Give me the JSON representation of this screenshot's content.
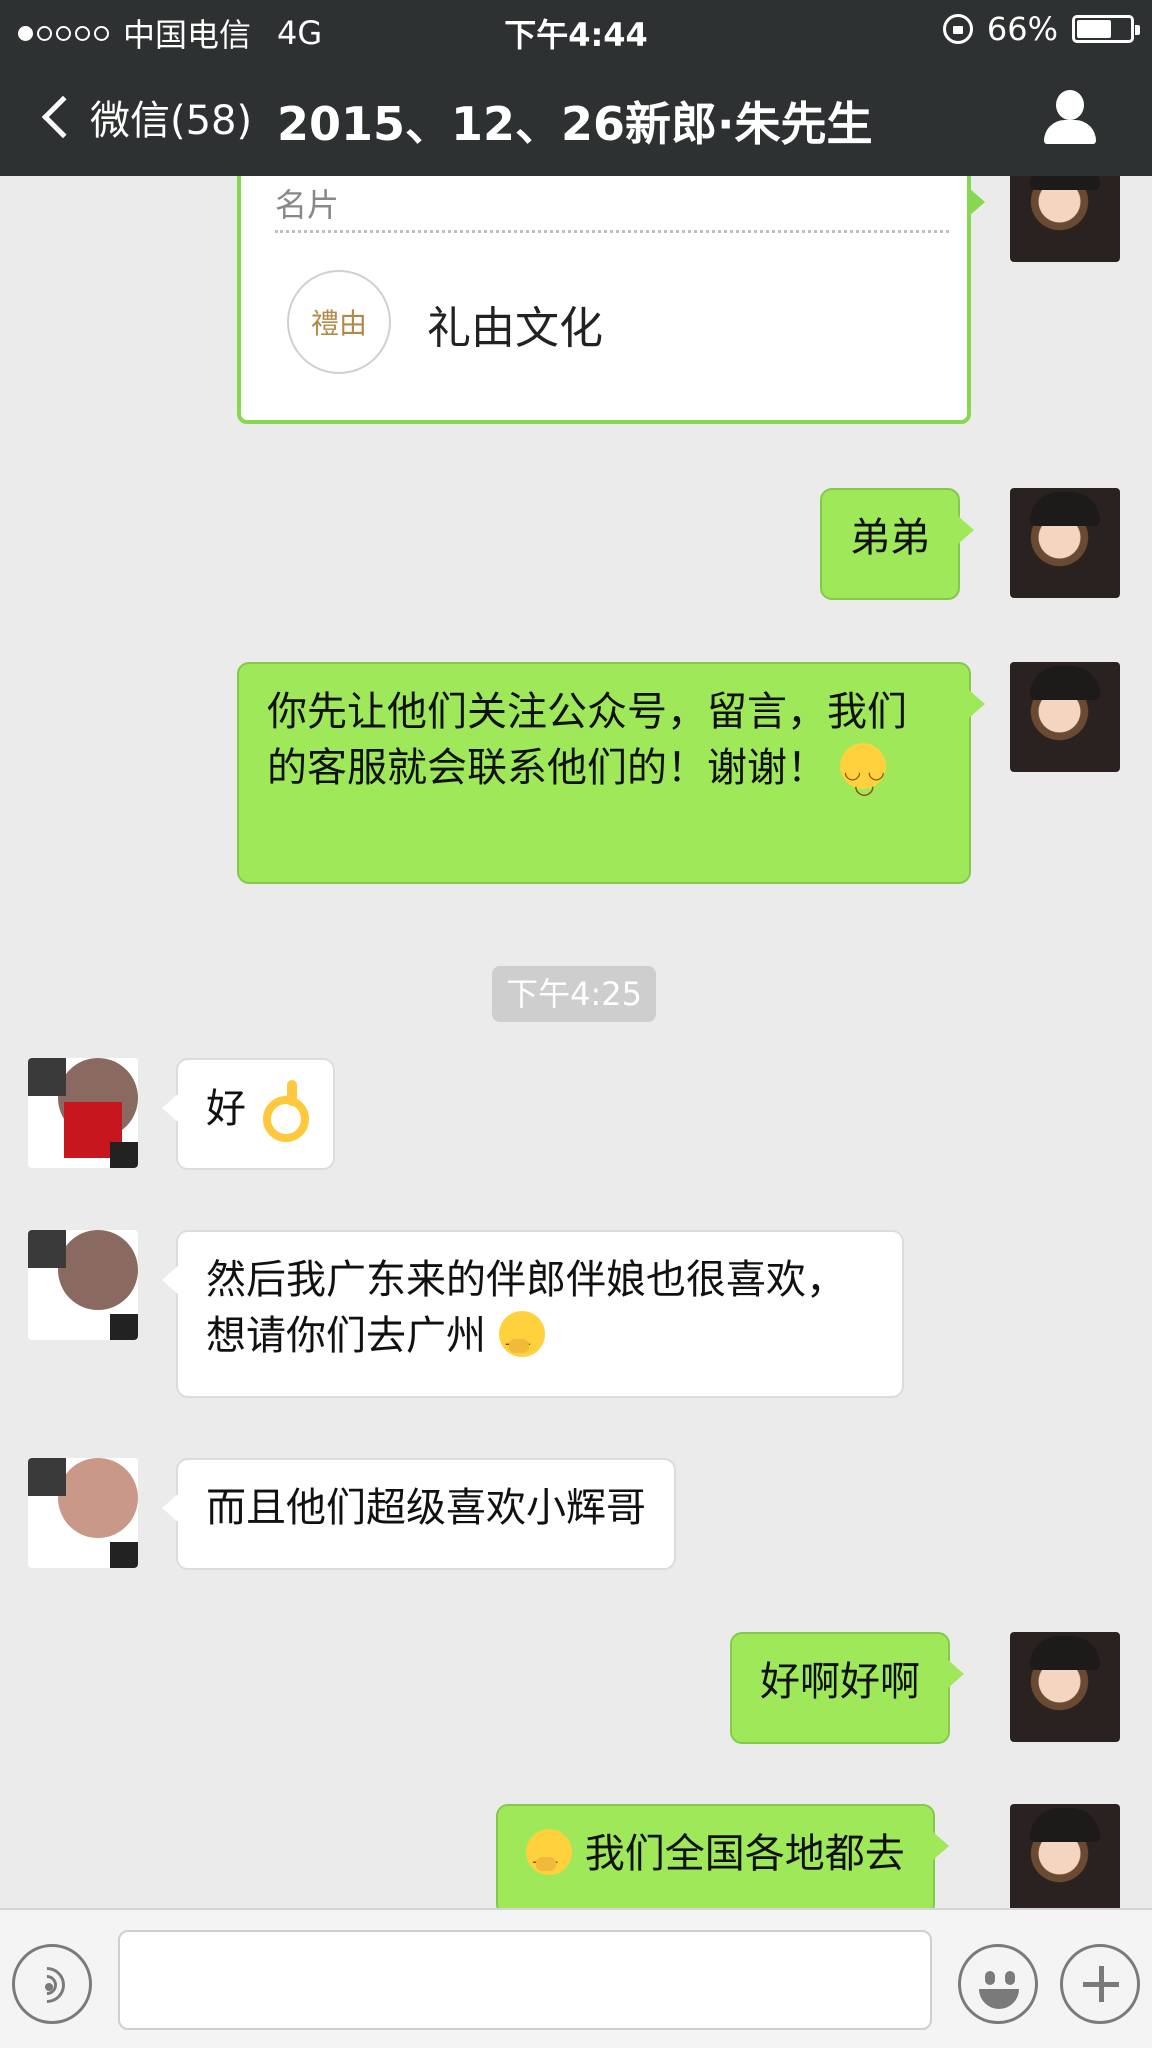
{
  "status_bar": {
    "signal_dots_filled": 1,
    "signal_dots_total": 5,
    "carrier": "中国电信",
    "network": "4G",
    "time": "下午4:44",
    "battery": "66%",
    "battery_level": 0.66
  },
  "nav": {
    "back_label": "微信(58)",
    "title": "2015、12、26新郎·朱先生"
  },
  "messages": {
    "card": {
      "type_label": "名片",
      "logo_text": "禮由",
      "name": "礼由文化"
    },
    "m1": "弟弟",
    "m2": "你先让他们关注公众号，留言，我们的客服就会联系他们的！谢谢！",
    "timestamp": "下午4:25",
    "r1": "好",
    "r2": "然后我广东来的伴郎伴娘也很喜欢，想请你们去广州",
    "r3": "而且他们超级喜欢小辉哥",
    "m3": "好啊好啊",
    "m4": "我们全国各地都去"
  },
  "toolbar": {
    "input_value": ""
  },
  "colors": {
    "my_bubble": "#9fe85a",
    "other_bubble": "#ffffff",
    "nav_bg": "#2e3132",
    "chat_bg": "#ebebeb"
  }
}
